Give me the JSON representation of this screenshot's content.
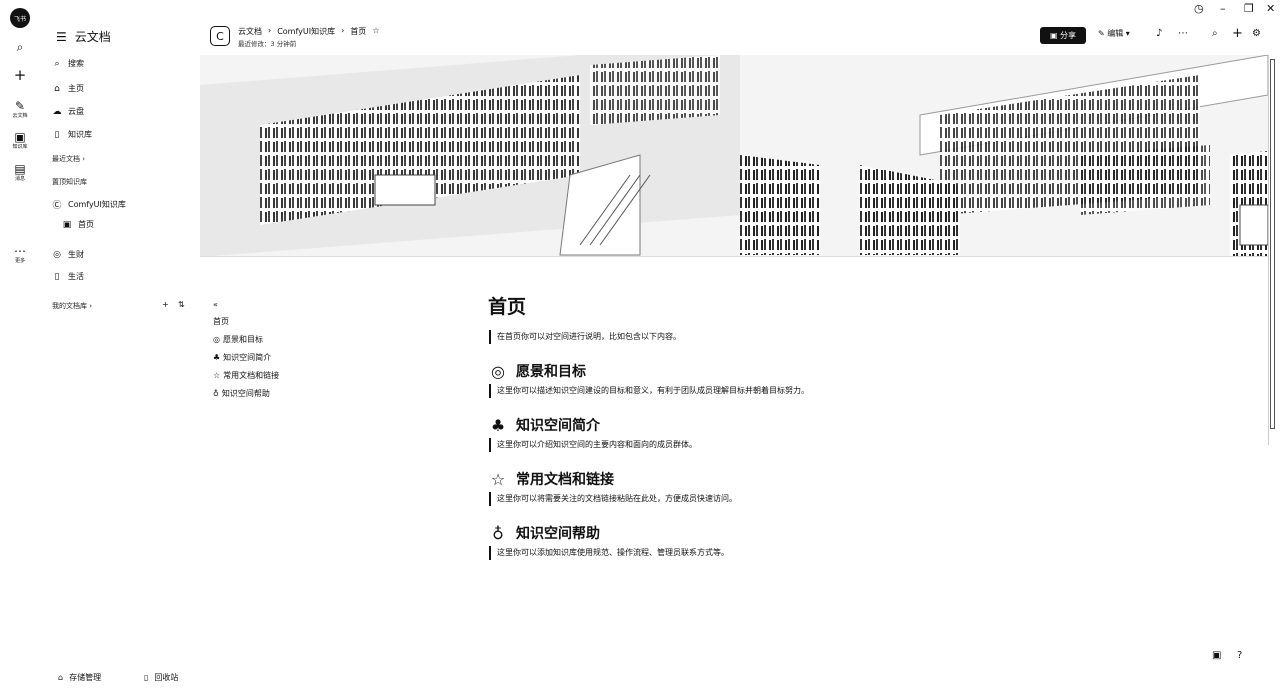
{
  "rail": {
    "avatar_text": "飞书",
    "items": [
      {
        "icon": "search-icon",
        "glyph": "⌕",
        "label": ""
      },
      {
        "icon": "plus-icon",
        "glyph": "+",
        "label": ""
      },
      {
        "icon": "doc-icon",
        "glyph": "✎",
        "label": "云文档"
      },
      {
        "icon": "book-icon",
        "glyph": "▣",
        "label": "知识库"
      },
      {
        "icon": "message-icon",
        "glyph": "▤",
        "label": "消息"
      },
      {
        "icon": "more-icon",
        "glyph": "⋯",
        "label": "更多"
      }
    ]
  },
  "sidebar": {
    "app_name": "云文档",
    "items": [
      {
        "icon": "search-icon",
        "glyph": "⌕",
        "label": "搜索"
      },
      {
        "icon": "home-icon",
        "glyph": "⌂",
        "label": "主页"
      },
      {
        "icon": "cloud-icon",
        "glyph": "☁",
        "label": "云盘"
      },
      {
        "icon": "book-icon",
        "glyph": "▯",
        "label": "知识库"
      }
    ],
    "section1": "最近文档 ›",
    "section2": "置顶知识库",
    "space_name": "ComfyUI知识库",
    "space_page": "首页",
    "extra_items": [
      {
        "icon": "app-icon",
        "glyph": "◎",
        "label": "生财"
      },
      {
        "icon": "life-icon",
        "glyph": "▯",
        "label": "生活"
      }
    ],
    "my_docs": "我的文档库 ›",
    "bottom_left": "存储管理",
    "bottom_right": "回收站"
  },
  "header": {
    "breadcrumb": [
      "云文档",
      "ComfyUI知识库",
      "首页",
      "☆"
    ],
    "last_modified": "最近修改：3 分钟前",
    "share_label": "分享",
    "edit_label": "编辑"
  },
  "outline": {
    "items": [
      {
        "glyph": "",
        "label": "首页"
      },
      {
        "glyph": "◎",
        "label": "愿景和目标"
      },
      {
        "glyph": "♣",
        "label": "知识空间简介"
      },
      {
        "glyph": "☆",
        "label": "常用文档和链接"
      },
      {
        "glyph": "♁",
        "label": "知识空间帮助"
      }
    ]
  },
  "doc": {
    "title": "首页",
    "intro": "在首页你可以对空间进行说明，比如包含以下内容。",
    "sections": [
      {
        "icon": "target-icon",
        "glyph": "◎",
        "heading": "愿景和目标",
        "text": "这里你可以描述知识空间建设的目标和意义，有利于团队成员理解目标并朝着目标努力。"
      },
      {
        "icon": "people-icon",
        "glyph": "♣",
        "heading": "知识空间简介",
        "text": "这里你可以介绍知识空间的主要内容和面向的成员群体。"
      },
      {
        "icon": "star-icon",
        "glyph": "☆",
        "heading": "常用文档和链接",
        "text": "这里你可以将需要关注的文档链接粘贴在此处，方便成员快速访问。"
      },
      {
        "icon": "bulb-icon",
        "glyph": "♁",
        "heading": "知识空间帮助",
        "text": "这里你可以添加知识库使用规范、操作流程、管理员联系方式等。"
      }
    ]
  }
}
